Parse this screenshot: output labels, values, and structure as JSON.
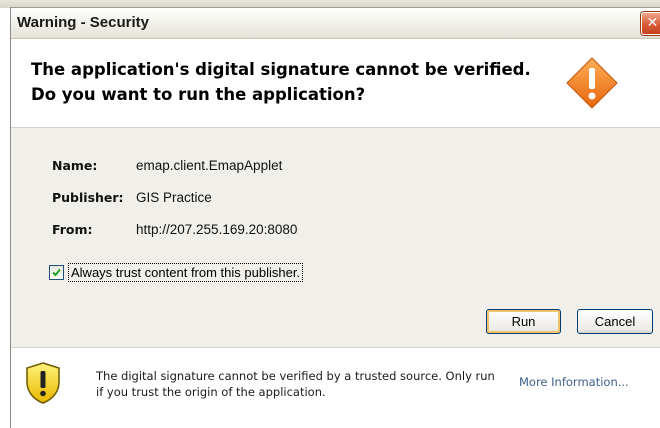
{
  "window": {
    "title": "Warning - Security",
    "close_glyph": "✕"
  },
  "header": {
    "line1": "The application's digital signature cannot be verified.",
    "line2": "Do you want to run the application?",
    "icon": "warning-diamond-icon"
  },
  "details": {
    "name_label": "Name:",
    "name_value": "emap.client.EmapApplet",
    "publisher_label": "Publisher:",
    "publisher_value": "GIS Practice",
    "from_label": "From:",
    "from_value": "http://207.255.169.20:8080"
  },
  "trust_checkbox": {
    "checked": true,
    "label": "Always trust content from this publisher."
  },
  "buttons": {
    "run": "Run",
    "cancel": "Cancel"
  },
  "footer": {
    "icon": "shield-warning-icon",
    "message": "The digital signature cannot be verified by a trusted source.  Only run if you trust the origin of the application.",
    "more_info": "More Information..."
  },
  "colors": {
    "warning_orange": "#f0781e",
    "shield_yellow": "#f5d10a",
    "link_blue": "#3d5f8a",
    "close_red": "#d85a34"
  }
}
